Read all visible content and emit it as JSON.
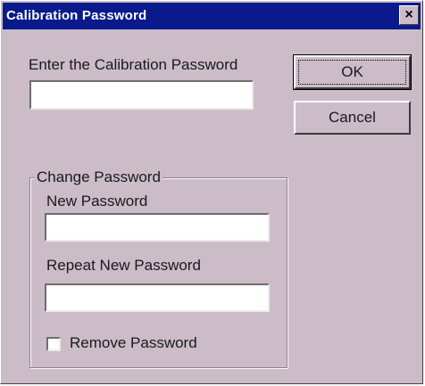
{
  "dialog": {
    "title": "Calibration Password",
    "close_glyph": "×"
  },
  "password": {
    "label": "Enter the Calibration Password",
    "value": ""
  },
  "buttons": {
    "ok_label": "OK",
    "cancel_label": "Cancel"
  },
  "change_password": {
    "caption": "Change Password",
    "new_label": "New Password",
    "new_value": "",
    "repeat_label": "Repeat New Password",
    "repeat_value": "",
    "remove_label": "Remove Password",
    "remove_checked": false
  },
  "colors": {
    "titlebar": "#0a1a8c",
    "dialog_face": "#cbbcc8"
  },
  "icons": {
    "close": "close-icon",
    "checkbox": "checkbox-unchecked-icon"
  }
}
